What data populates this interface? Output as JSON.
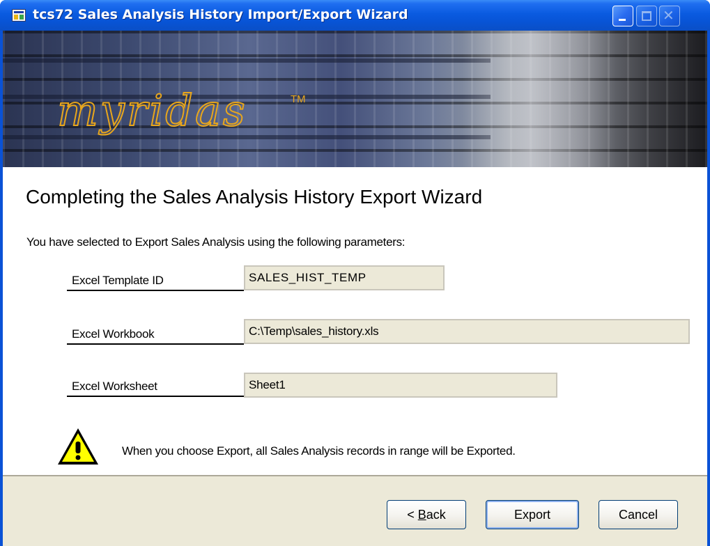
{
  "window": {
    "title": "tcs72 Sales Analysis History Import/Export Wizard"
  },
  "banner": {
    "logo_text": "myridas",
    "trademark": "TM"
  },
  "page": {
    "heading": "Completing the Sales Analysis History Export Wizard",
    "intro": "You have selected to Export Sales Analysis using the following parameters:"
  },
  "parameters": [
    {
      "label": "Excel Template ID",
      "value": "SALES_HIST_TEMP"
    },
    {
      "label": "Excel Workbook",
      "value": "C:\\Temp\\sales_history.xls"
    },
    {
      "label": "Excel Worksheet",
      "value": "Sheet1"
    }
  ],
  "warning": {
    "icon": "warning-icon",
    "text": "When you choose Export, all Sales Analysis records in range will be Exported."
  },
  "buttons": {
    "back_prefix": "< ",
    "back_mnemonic": "B",
    "back_rest": "ack",
    "export": "Export",
    "cancel": "Cancel"
  },
  "colors": {
    "titlebar": "#0a5be0",
    "logo": "#e8a61c",
    "panel": "#ece9d8",
    "field_bg": "#ece9d8"
  }
}
